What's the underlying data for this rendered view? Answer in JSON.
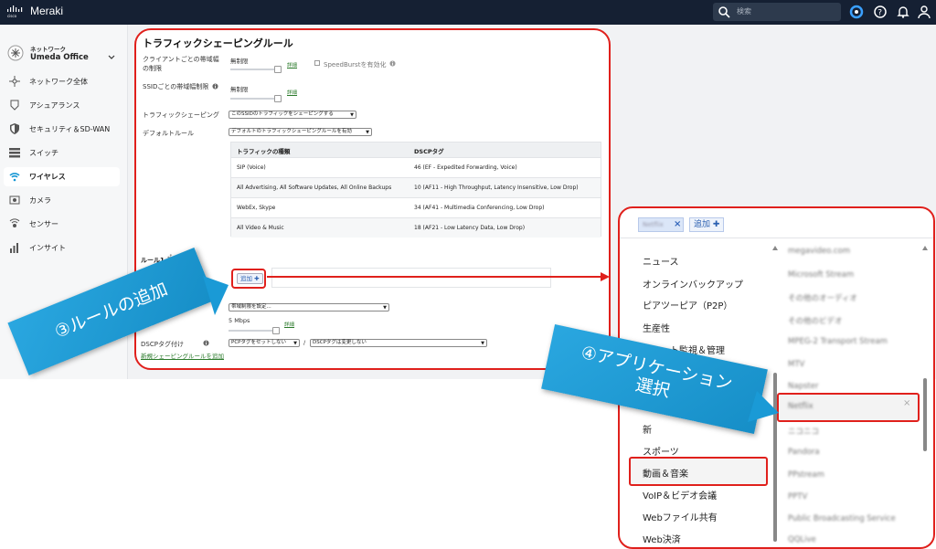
{
  "topbar": {
    "brand": "Meraki",
    "search_placeholder": "検索"
  },
  "sidebar": {
    "network_caption": "ネットワーク",
    "network_name": "Umeda Office",
    "items": [
      {
        "label": "ネットワーク全体",
        "icon": "network-wide-icon"
      },
      {
        "label": "アシュアランス",
        "icon": "assurance-icon"
      },
      {
        "label": "セキュリティ＆SD-WAN",
        "icon": "shield-icon"
      },
      {
        "label": "スイッチ",
        "icon": "switch-icon"
      },
      {
        "label": "ワイヤレス",
        "icon": "wifi-icon",
        "active": true
      },
      {
        "label": "カメラ",
        "icon": "camera-icon"
      },
      {
        "label": "センサー",
        "icon": "sensor-icon"
      },
      {
        "label": "インサイト",
        "icon": "insight-icon"
      }
    ]
  },
  "main": {
    "title": "トラフィックシェーピングルール",
    "client_limit_label_1": "クライアントごとの帯域幅",
    "client_limit_label_2": "の制限",
    "client_limit_value": "無制限",
    "details_link": "詳細",
    "speedburst_label": "SpeedBurstを有効化",
    "ssid_limit_label": "SSIDごとの帯域幅制限",
    "ssid_limit_value": "無制限",
    "shaping_label": "トラフィックシェーピング",
    "shaping_select": "このSSIDのトラフィックをシェーピングする",
    "default_rules_label": "デフォルトルール",
    "default_rules_select": "デフォルトのトラフィックシェーピングルールを有効",
    "table": {
      "headers": [
        "トラフィックの種類",
        "DSCPタグ"
      ],
      "rows": [
        [
          "SIP (Voice)",
          "46 (EF - Expedited Forwarding, Voice)"
        ],
        [
          "All Advertising, All Software Updates, All Online Backups",
          "10 (AF11 - High Throughput, Latency Insensitive, Low Drop)"
        ],
        [
          "WebEx, Skype",
          "34 (AF41 - Multimedia Conferencing, Low Drop)"
        ],
        [
          "All Video & Music",
          "18 (AF21 - Low Latency Data, Low Drop)"
        ]
      ]
    },
    "rule_label": "ルール1",
    "definition_label": "定義",
    "add_button": "追加 ✚",
    "bandwidth_select": "帯域制限を設定...",
    "bandwidth_value": "5 Mbps",
    "dscp_label": "DSCPタグ付け",
    "pcp_select": "PCPタグをセットしない",
    "slash": "/",
    "dscp_select": "DSCPタグは変更しない",
    "new_rule_link": "新規シェーピングルールを追加"
  },
  "callouts": {
    "step3": "③ルールの追加",
    "step4_line1": "④アプリケーション",
    "step4_line2": "選択"
  },
  "picker": {
    "selected_tag": "Netflix",
    "add_chip": "追加 ✚",
    "categories": [
      "ニュース",
      "オンラインバックアップ",
      "ピアツーピア（P2P）",
      "生産性",
      "リモート監視＆管理",
      "新",
      "スポーツ",
      "動画＆音楽",
      "VoIP＆ビデオ会議",
      "Webファイル共有",
      "Web決済"
    ],
    "apps": [
      "megavideo.com",
      "Microsoft Stream",
      "その他のオーディオ",
      "その他のビデオ",
      "MPEG-2 Transport Stream",
      "MTV",
      "Napster",
      "Netflix",
      "ニコニコ",
      "Pandora",
      "PPstream",
      "PPTV",
      "Public Broadcasting Service",
      "QQLive"
    ]
  },
  "colors": {
    "highlight": "#e0201c",
    "callout": "#1a9ad6",
    "topbar": "#152033"
  }
}
